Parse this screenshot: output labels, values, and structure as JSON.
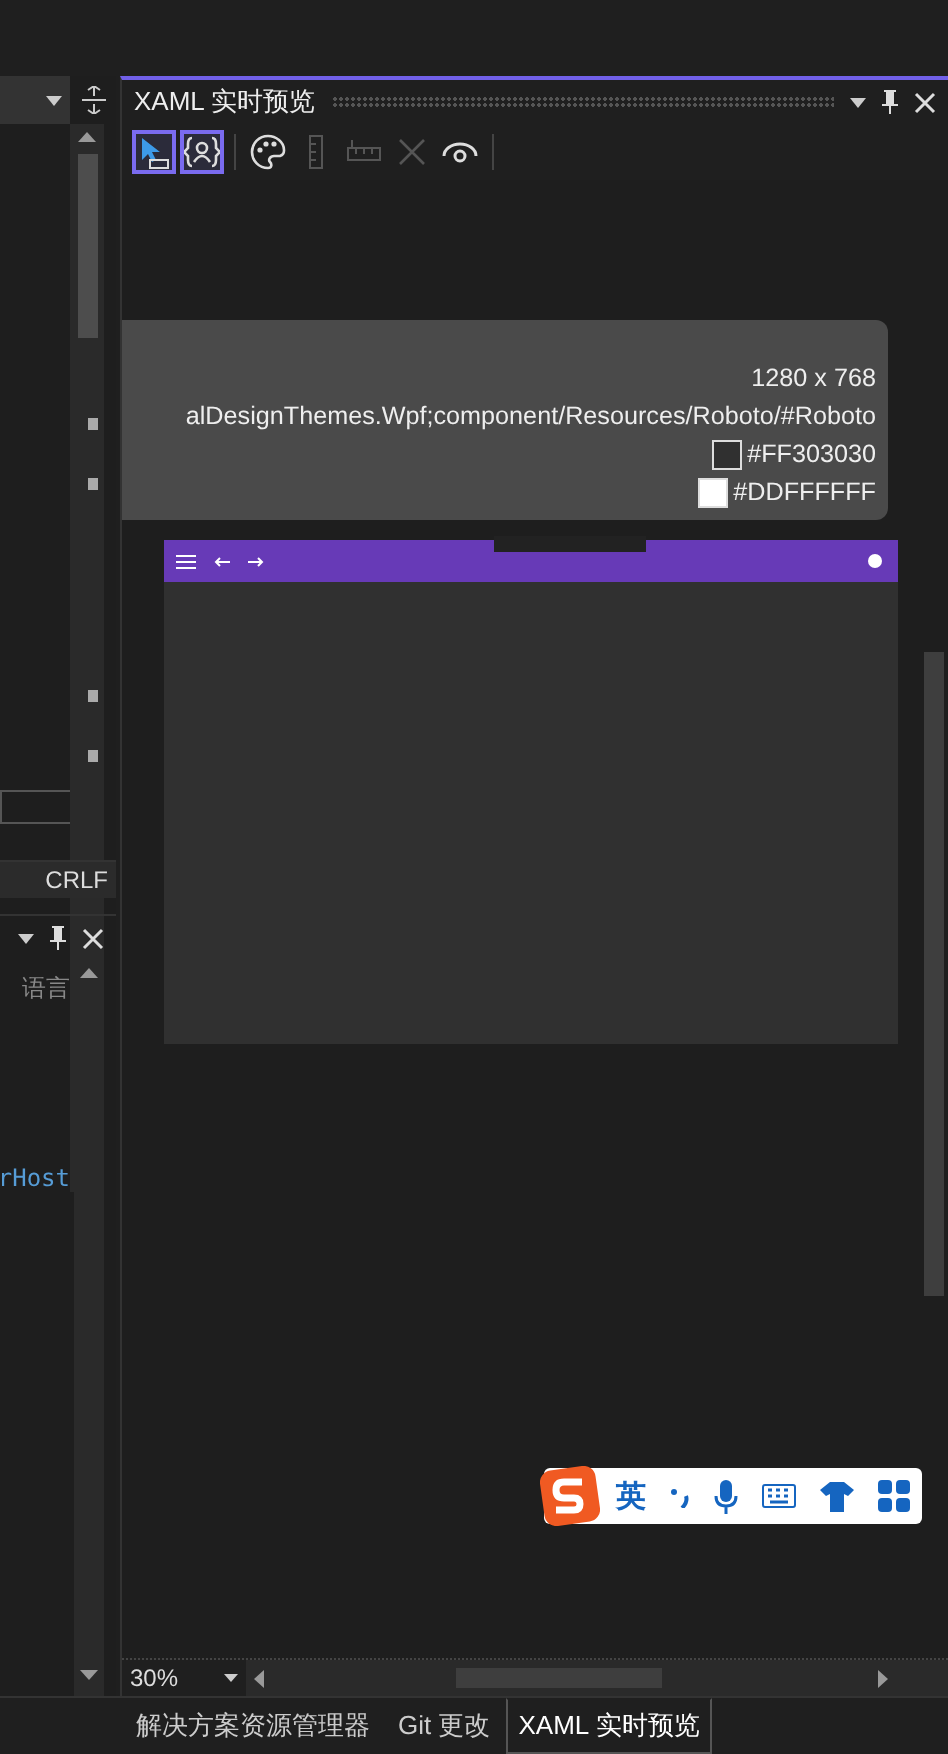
{
  "editor": {
    "code_text": "rHost",
    "line_ending": "CRLF"
  },
  "bottom_panel": {
    "column_header": "语言"
  },
  "preview_panel": {
    "title": "XAML 实时预览",
    "tools": [
      {
        "kind": "select",
        "selected": true,
        "disabled": false
      },
      {
        "kind": "adorner",
        "selected": true,
        "disabled": false
      },
      {
        "kind": "palette",
        "selected": false,
        "disabled": false
      },
      {
        "kind": "ruler-v",
        "selected": false,
        "disabled": true
      },
      {
        "kind": "ruler-h",
        "selected": false,
        "disabled": true
      },
      {
        "kind": "clear",
        "selected": false,
        "disabled": true
      },
      {
        "kind": "eye",
        "selected": false,
        "disabled": false
      }
    ],
    "info": {
      "size": "1280 x 768",
      "font": "alDesignThemes.Wpf;component/Resources/Roboto/#Roboto",
      "colors": [
        {
          "value": "#FF303030",
          "color": "#303030"
        },
        {
          "value": "#DDFFFFFF",
          "color": "#ffffff"
        }
      ]
    },
    "zoom": "30%"
  },
  "tabs": [
    {
      "label": "解决方案资源管理器",
      "selected": false
    },
    {
      "label": "Git 更改",
      "selected": false
    },
    {
      "label": "XAML 实时预览",
      "selected": true
    }
  ],
  "ime": {
    "mode": "英"
  }
}
